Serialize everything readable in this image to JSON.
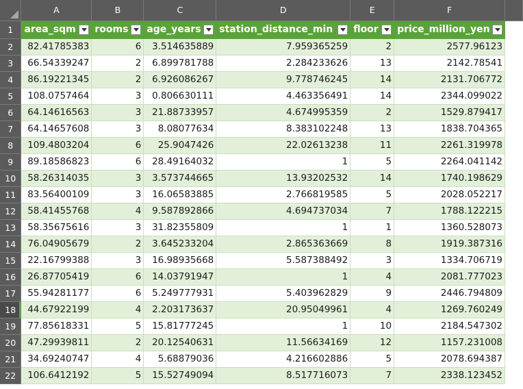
{
  "columns": [
    "A",
    "B",
    "C",
    "D",
    "E",
    "F"
  ],
  "headers": [
    "area_sqm",
    "rooms",
    "age_years",
    "station_distance_min",
    "floor",
    "price_million_yen"
  ],
  "rows": [
    {
      "n": "2",
      "v": [
        "82.41785383",
        "6",
        "3.514635889",
        "7.959365259",
        "2",
        "2577.96123"
      ]
    },
    {
      "n": "3",
      "v": [
        "66.54339247",
        "2",
        "6.899781788",
        "2.284233626",
        "13",
        "2142.78541"
      ]
    },
    {
      "n": "4",
      "v": [
        "86.19221345",
        "2",
        "6.926086267",
        "9.778746245",
        "14",
        "2131.706772"
      ]
    },
    {
      "n": "5",
      "v": [
        "108.0757464",
        "3",
        "0.806630111",
        "4.463356491",
        "14",
        "2344.099022"
      ]
    },
    {
      "n": "6",
      "v": [
        "64.14616563",
        "3",
        "21.88733957",
        "4.674995359",
        "2",
        "1529.879417"
      ]
    },
    {
      "n": "7",
      "v": [
        "64.14657608",
        "3",
        "8.08077634",
        "8.383102248",
        "13",
        "1838.704365"
      ]
    },
    {
      "n": "8",
      "v": [
        "109.4803204",
        "6",
        "25.9047426",
        "22.02613238",
        "11",
        "2261.319978"
      ]
    },
    {
      "n": "9",
      "v": [
        "89.18586823",
        "6",
        "28.49164032",
        "1",
        "5",
        "2264.041142"
      ]
    },
    {
      "n": "10",
      "v": [
        "58.26314035",
        "3",
        "3.573744665",
        "13.93202532",
        "14",
        "1740.198629"
      ]
    },
    {
      "n": "11",
      "v": [
        "83.56400109",
        "3",
        "16.06583885",
        "2.766819585",
        "5",
        "2028.052217"
      ]
    },
    {
      "n": "12",
      "v": [
        "58.41455768",
        "4",
        "9.587892866",
        "4.694737034",
        "7",
        "1788.122215"
      ]
    },
    {
      "n": "13",
      "v": [
        "58.35675616",
        "3",
        "31.82355809",
        "1",
        "1",
        "1360.528073"
      ]
    },
    {
      "n": "14",
      "v": [
        "76.04905679",
        "2",
        "3.645233204",
        "2.865363669",
        "8",
        "1919.387316"
      ]
    },
    {
      "n": "15",
      "v": [
        "22.16799388",
        "3",
        "16.98935668",
        "5.587388492",
        "3",
        "1334.706719"
      ]
    },
    {
      "n": "16",
      "v": [
        "26.87705419",
        "6",
        "14.03791947",
        "1",
        "4",
        "2081.777023"
      ]
    },
    {
      "n": "17",
      "v": [
        "55.94281177",
        "6",
        "5.249777931",
        "5.403962829",
        "9",
        "2446.794809"
      ]
    },
    {
      "n": "18",
      "v": [
        "44.67922199",
        "4",
        "2.203173637",
        "20.95049961",
        "4",
        "1269.760249"
      ]
    },
    {
      "n": "19",
      "v": [
        "77.85618331",
        "5",
        "15.81777245",
        "1",
        "10",
        "2184.547302"
      ]
    },
    {
      "n": "20",
      "v": [
        "47.29939811",
        "2",
        "20.12540631",
        "11.56634169",
        "12",
        "1157.231008"
      ]
    },
    {
      "n": "21",
      "v": [
        "34.69240747",
        "4",
        "5.68879036",
        "4.216602886",
        "5",
        "2078.694387"
      ]
    },
    {
      "n": "22",
      "v": [
        "106.6412192",
        "5",
        "15.52749094",
        "8.517716073",
        "7",
        "2338.123452"
      ]
    }
  ],
  "header_row_num": "1",
  "active_row": "18",
  "colors": {
    "header_green": "#5aa33a",
    "band_green": "#e2f0d9",
    "grid_dark": "#5b5b5b"
  }
}
